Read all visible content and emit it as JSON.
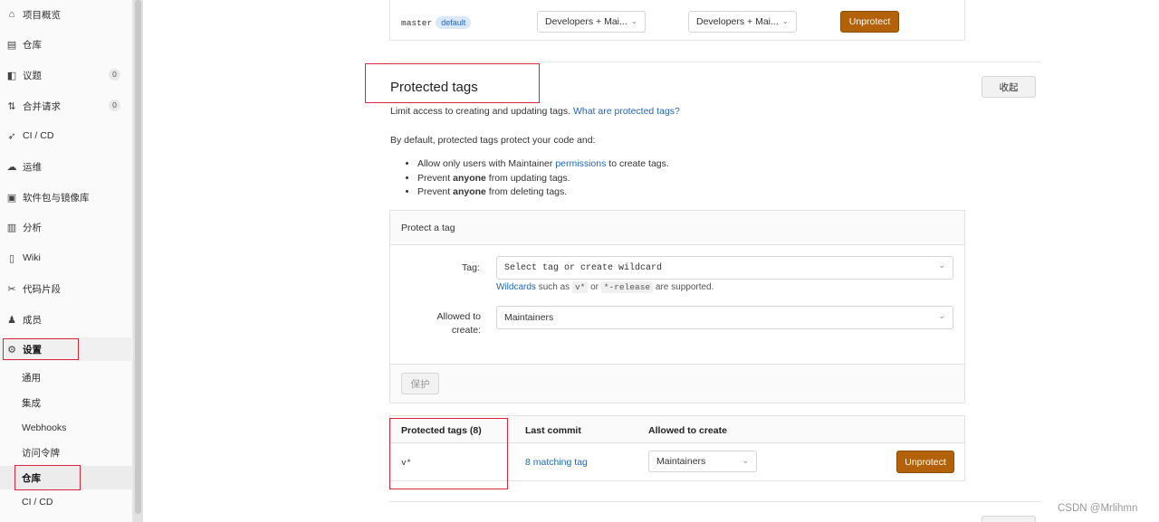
{
  "sidebar": {
    "items": [
      {
        "icon": "home-icon",
        "glyph": "⌂",
        "label": "项目概览"
      },
      {
        "icon": "file-icon",
        "glyph": "▤",
        "label": "仓库"
      },
      {
        "icon": "issues-icon",
        "glyph": "◧",
        "label": "议题",
        "count": "0"
      },
      {
        "icon": "merge-request-icon",
        "glyph": "⇅",
        "label": "合并请求",
        "count": "0"
      },
      {
        "icon": "rocket-icon",
        "glyph": "➶",
        "label": "CI / CD"
      },
      {
        "icon": "cloud-icon",
        "glyph": "☁",
        "label": "运维"
      },
      {
        "icon": "package-icon",
        "glyph": "▣",
        "label": "软件包与镜像库"
      },
      {
        "icon": "chart-icon",
        "glyph": "▥",
        "label": "分析"
      },
      {
        "icon": "book-icon",
        "glyph": "▯",
        "label": "Wiki"
      },
      {
        "icon": "scissors-icon",
        "glyph": "✂",
        "label": "代码片段"
      },
      {
        "icon": "users-icon",
        "glyph": "♟",
        "label": "成员"
      },
      {
        "icon": "gear-icon",
        "glyph": "⚙",
        "label": "设置"
      }
    ],
    "sub_items": [
      {
        "label": "通用"
      },
      {
        "label": "集成"
      },
      {
        "label": "Webhooks"
      },
      {
        "label": "访问令牌"
      },
      {
        "label": "仓库"
      },
      {
        "label": "CI / CD"
      }
    ]
  },
  "protected_branch": {
    "branch": "master",
    "badge": "default",
    "allowed_to_merge": "Developers + Mai...",
    "allowed_to_push": "Developers + Mai...",
    "unprotect_label": "Unprotect"
  },
  "protected_tags": {
    "title": "Protected tags",
    "collapse_label": "收起",
    "intro": "Limit access to creating and updating tags.",
    "intro_link": "What are protected tags?",
    "by_default": "By default, protected tags protect your code and:",
    "bullets": {
      "b1_pre": "Allow only users with Maintainer",
      "b1_link": "permissions",
      "b1_post": "to create tags.",
      "b2_pre": "Prevent",
      "b2_bold": "anyone",
      "b2_post": "from updating tags.",
      "b3_pre": "Prevent",
      "b3_bold": "anyone",
      "b3_post": "from deleting tags."
    },
    "form": {
      "header": "Protect a tag",
      "tag_label": "Tag:",
      "tag_placeholder": "Select tag or create wildcard",
      "wildcards_link": "Wildcards",
      "wildcards_text1": "such as",
      "wildcard_example1": "v*",
      "wildcards_or": "or",
      "wildcard_example2": "*-release",
      "wildcards_text2": "are supported.",
      "allowed_label": "Allowed to create:",
      "allowed_value": "Maintainers",
      "protect_button": "保护"
    },
    "table": {
      "col_tags": "Protected tags (8)",
      "col_commit": "Last commit",
      "col_allowed": "Allowed to create",
      "rows": [
        {
          "tag": "v*",
          "commit": "8 matching tag",
          "allowed": "Maintainers",
          "action": "Unprotect"
        }
      ]
    }
  },
  "watermark": "CSDN @Mrlihmn"
}
